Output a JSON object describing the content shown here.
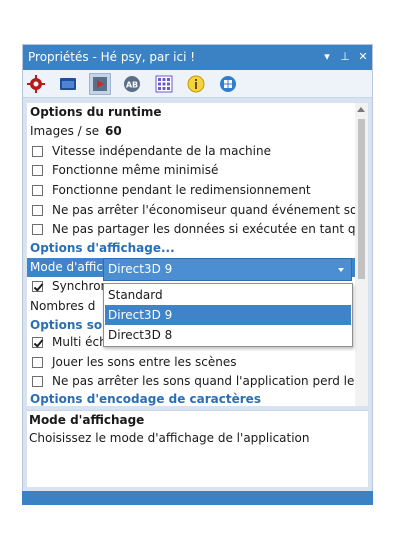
{
  "window": {
    "title": "Propriétés - Hé psy, par ici !"
  },
  "title_buttons": {
    "dropdown": "▾",
    "pin": "⊥",
    "close": "✕"
  },
  "toolbar": {
    "icons": [
      "gear-icon",
      "window-icon",
      "play-icon",
      "font-icon",
      "grid-icon",
      "info-icon",
      "windows-icon"
    ],
    "active_index": 2
  },
  "grid": {
    "section_runtime": "Options du runtime",
    "images_label": "Images / se",
    "images_value": "60",
    "checkboxes_runtime": [
      {
        "label": "Vitesse indépendante de la machine",
        "checked": false
      },
      {
        "label": "Fonctionne même minimisé",
        "checked": false
      },
      {
        "label": "Fonctionne pendant le redimensionnement",
        "checked": false
      },
      {
        "label": "Ne pas arrêter l'économiseur quand événement so",
        "checked": false
      },
      {
        "label": "Ne pas partager les données si exécutée en tant qu",
        "checked": false
      }
    ],
    "section_display": "Options d'affichage...",
    "display_mode_label": "Mode d'affic",
    "sync_label": "Synchron",
    "sync_checked": true,
    "numbers_label": "Nombres d",
    "section_sound": "Options son",
    "multi_label": "Multi éch",
    "multi_checked": true,
    "checkboxes_sound": [
      {
        "label": "Jouer les sons entre les scènes",
        "checked": false
      },
      {
        "label": "Ne pas arrêter les sons quand l'application perd le",
        "checked": false
      }
    ],
    "section_encoding": "Options d'encodage de caractères"
  },
  "dropdown": {
    "value": "Direct3D 9",
    "options": [
      "Standard",
      "Direct3D 9",
      "Direct3D 8"
    ],
    "selected_index": 1
  },
  "description": {
    "title": "Mode d'affichage",
    "text": "Choisissez le mode d'affichage de l'application"
  },
  "colors": {
    "accent": "#3b82c4",
    "selection": "#3f84c8",
    "category": "#2a6fb5"
  }
}
